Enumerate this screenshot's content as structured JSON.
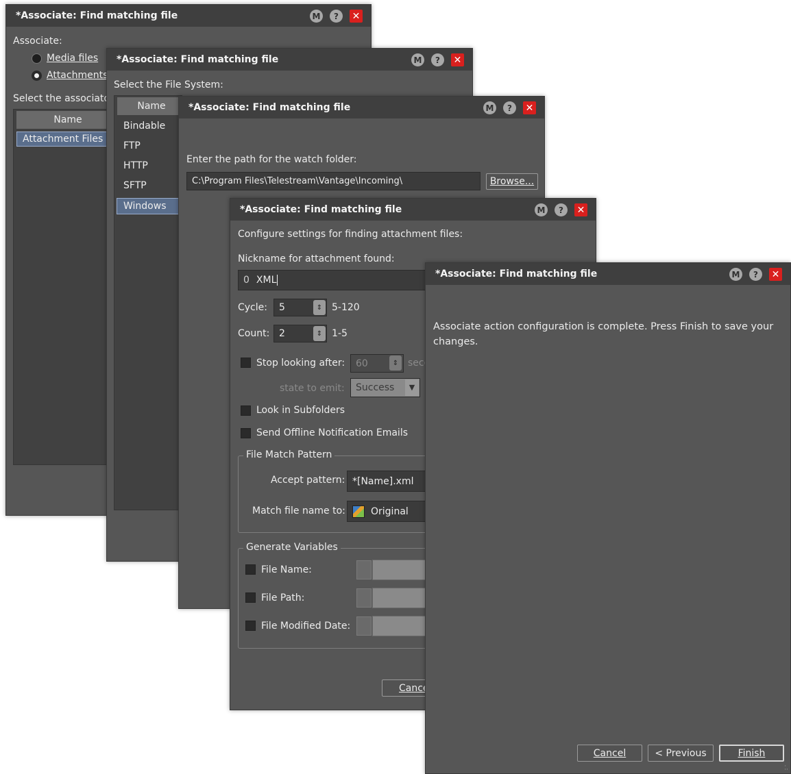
{
  "dialogs": {
    "title": "*Associate: Find matching file",
    "m_label": "M",
    "help_label": "?",
    "close_label": "✕"
  },
  "step1": {
    "associate_label": "Associate:",
    "media_files": "Media files",
    "attachments": "Attachments",
    "select_label": "Select the associator",
    "name_header": "Name",
    "rows": [
      "Attachment Files"
    ],
    "selected_radio": "attachments"
  },
  "step2": {
    "select_fs_label": "Select the File System:",
    "name_header": "Name",
    "rows": [
      "Bindable",
      "FTP",
      "HTTP",
      "SFTP",
      "Windows"
    ],
    "selected_row": "Windows"
  },
  "step3": {
    "path_label": "Enter the path for the watch folder:",
    "path_value": "C:\\Program Files\\Telestream\\Vantage\\Incoming\\",
    "browse_label": "Browse..."
  },
  "step4": {
    "configure_label": "Configure settings for finding attachment files:",
    "nickname_label": "Nickname for attachment found:",
    "nickname_value": "XML",
    "paperclip_glyph": "0",
    "cycle_label": "Cycle:",
    "cycle_value": "5",
    "cycle_range": "5-120",
    "count_label": "Count:",
    "count_value": "2",
    "count_range": "1-5",
    "stop_label": "Stop looking after:",
    "stop_value": "60",
    "stop_unit": "seco",
    "state_label": "state to emit:",
    "state_value": "Success",
    "subfolders_label": "Look in Subfolders",
    "offline_label": "Send Offline Notification Emails",
    "file_match_group": "File Match Pattern",
    "accept_label": "Accept pattern:",
    "accept_value": "*[Name].xml",
    "matchname_label": "Match file name to:",
    "matchname_value": "Original",
    "gen_vars_group": "Generate Variables",
    "file_name_label": "File Name:",
    "file_path_label": "File Path:",
    "file_mod_label": "File Modified Date:",
    "cancel_label": "Cance"
  },
  "step5": {
    "message": "Associate action configuration is complete.  Press Finish to save your changes.",
    "cancel_label": "Cancel",
    "previous_label": "< Previous",
    "finish_label": "Finish"
  },
  "colors": {
    "dialog_bg": "#565656",
    "titlebar_bg": "#3f3f3f",
    "close_red": "#d9201e",
    "selection_blue": "#5a7aa6"
  }
}
